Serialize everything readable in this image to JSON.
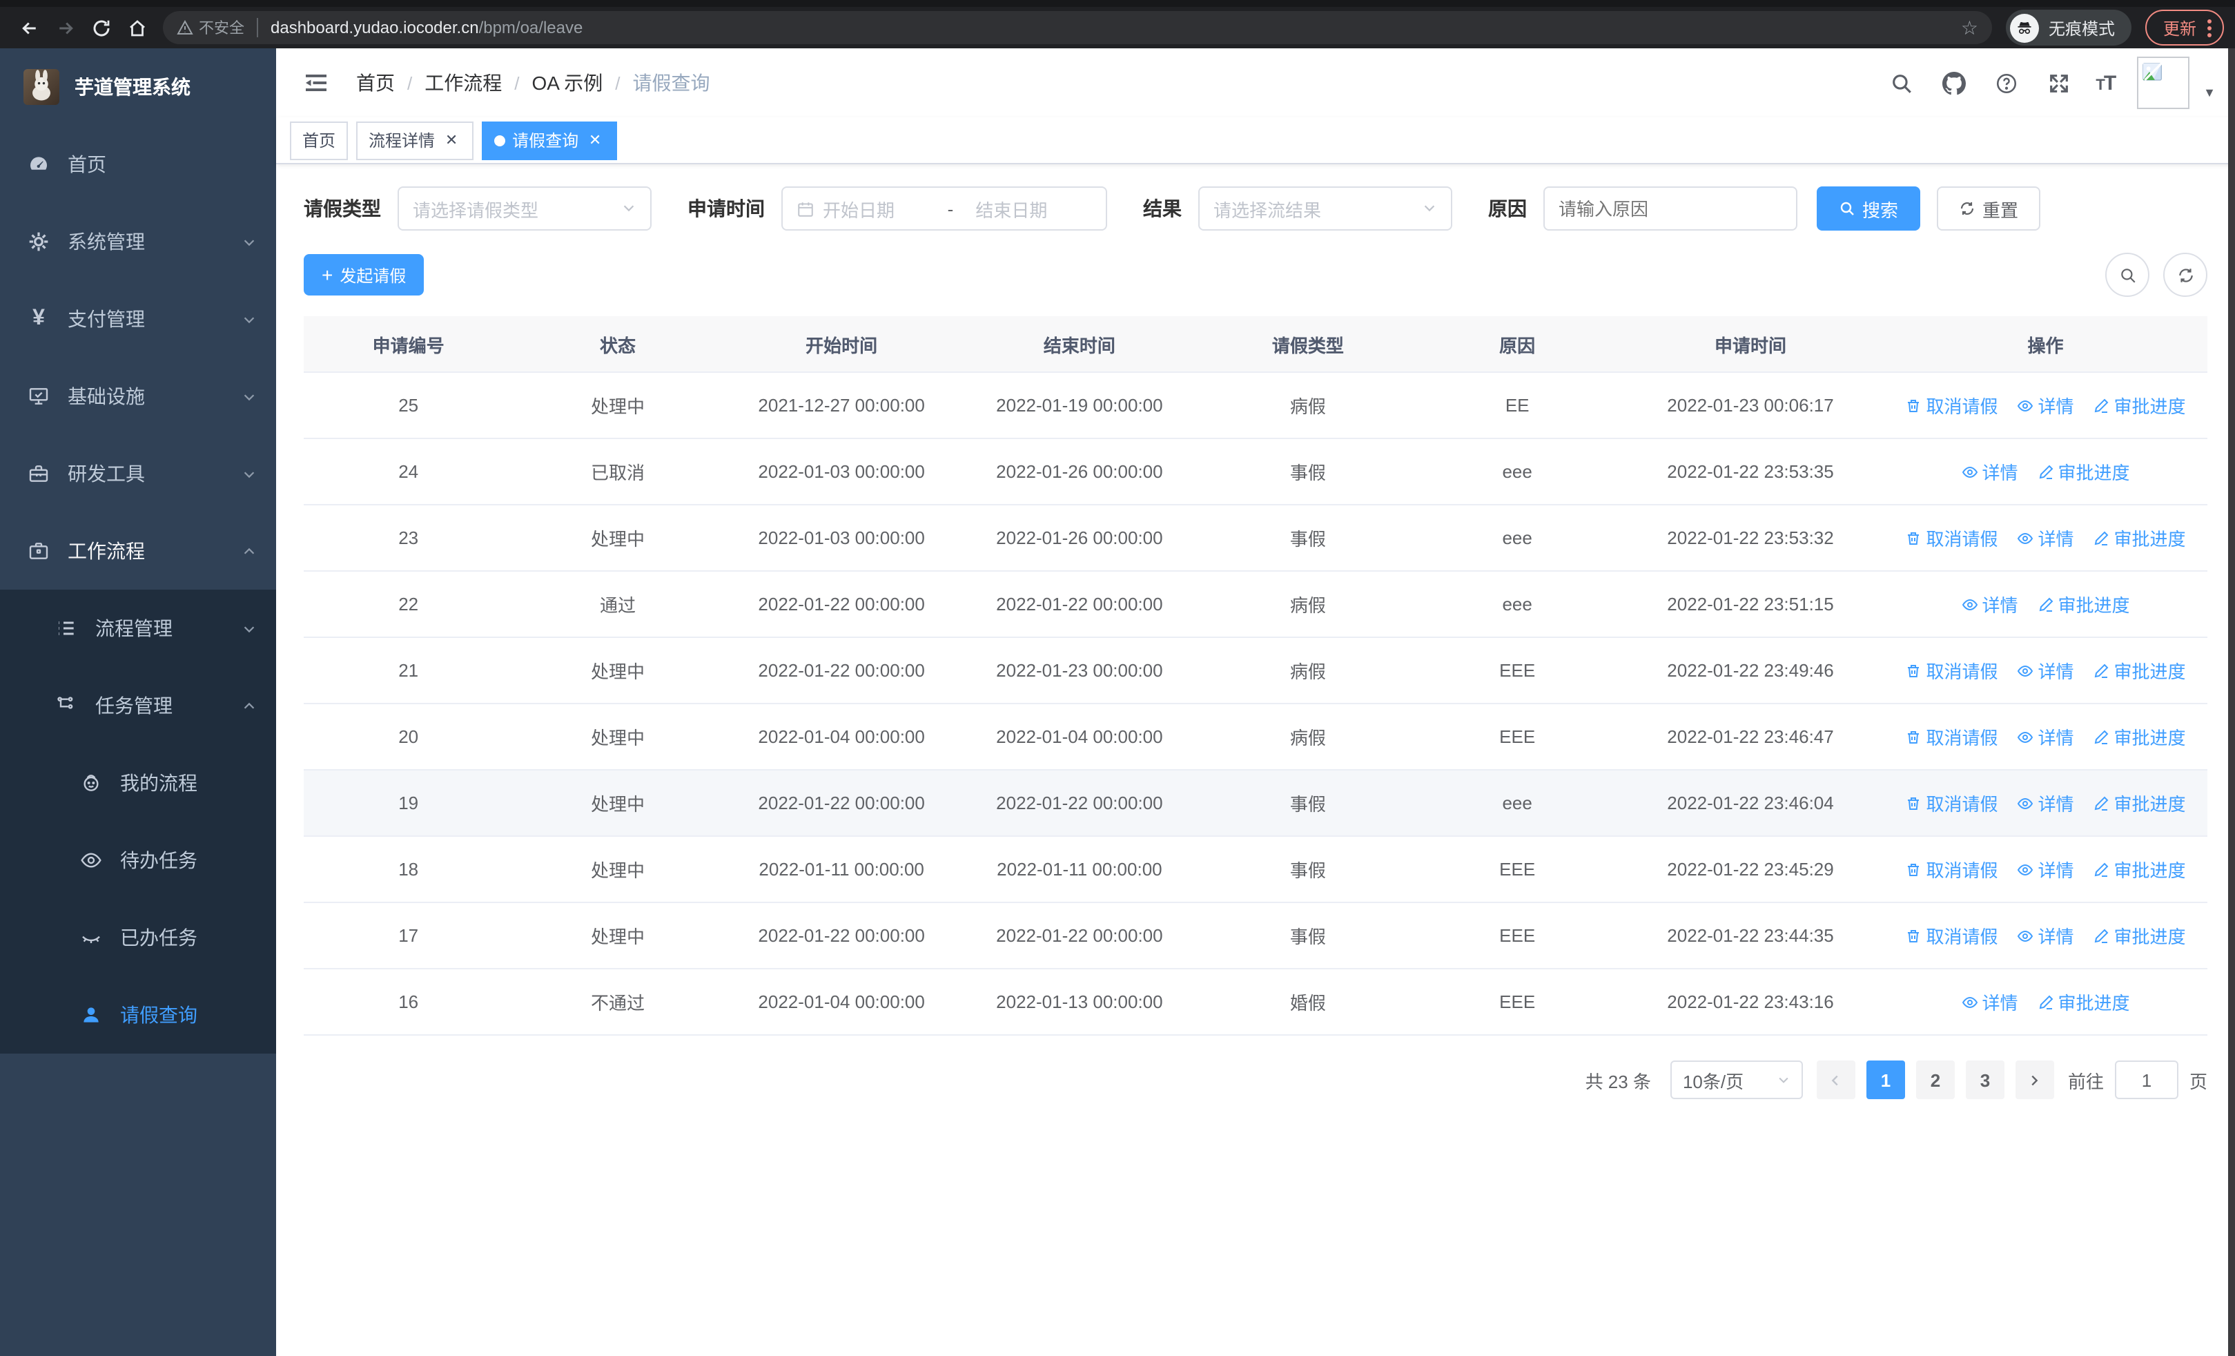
{
  "browser": {
    "security_label": "不安全",
    "url_host": "dashboard.yudao.iocoder.cn",
    "url_path": "/bpm/oa/leave",
    "incognito_label": "无痕模式",
    "update_label": "更新"
  },
  "sidebar": {
    "logo_title": "芋道管理系统",
    "items": [
      {
        "label": "首页"
      },
      {
        "label": "系统管理"
      },
      {
        "label": "支付管理"
      },
      {
        "label": "基础设施"
      },
      {
        "label": "研发工具"
      },
      {
        "label": "工作流程"
      }
    ],
    "workflow_children": [
      {
        "label": "流程管理"
      },
      {
        "label": "任务管理"
      }
    ],
    "task_children": [
      {
        "label": "我的流程"
      },
      {
        "label": "待办任务"
      },
      {
        "label": "已办任务"
      },
      {
        "label": "请假查询"
      }
    ]
  },
  "navbar": {
    "breadcrumb": [
      "首页",
      "工作流程",
      "OA 示例",
      "请假查询"
    ]
  },
  "tags": [
    {
      "label": "首页",
      "closable": false,
      "active": false
    },
    {
      "label": "流程详情",
      "closable": true,
      "active": false
    },
    {
      "label": "请假查询",
      "closable": true,
      "active": true
    }
  ],
  "filters": {
    "leave_type_label": "请假类型",
    "leave_type_placeholder": "请选择请假类型",
    "apply_time_label": "申请时间",
    "start_date_placeholder": "开始日期",
    "range_separator": "-",
    "end_date_placeholder": "结束日期",
    "result_label": "结果",
    "result_placeholder": "请选择流结果",
    "reason_label": "原因",
    "reason_placeholder": "请输入原因",
    "search_label": "搜索",
    "reset_label": "重置"
  },
  "toolbar": {
    "create_label": "发起请假"
  },
  "table": {
    "columns": [
      "申请编号",
      "状态",
      "开始时间",
      "结束时间",
      "请假类型",
      "原因",
      "申请时间",
      "操作"
    ],
    "action_labels": {
      "cancel": "取消请假",
      "detail": "详情",
      "progress": "审批进度"
    },
    "rows": [
      {
        "id": "25",
        "status": "处理中",
        "start": "2021-12-27 00:00:00",
        "end": "2022-01-19 00:00:00",
        "type": "病假",
        "reason": "EE",
        "apply_time": "2022-01-23 00:06:17",
        "actions": [
          "cancel",
          "detail",
          "progress"
        ],
        "highlight": false
      },
      {
        "id": "24",
        "status": "已取消",
        "start": "2022-01-03 00:00:00",
        "end": "2022-01-26 00:00:00",
        "type": "事假",
        "reason": "eee",
        "apply_time": "2022-01-22 23:53:35",
        "actions": [
          "detail",
          "progress"
        ],
        "highlight": false
      },
      {
        "id": "23",
        "status": "处理中",
        "start": "2022-01-03 00:00:00",
        "end": "2022-01-26 00:00:00",
        "type": "事假",
        "reason": "eee",
        "apply_time": "2022-01-22 23:53:32",
        "actions": [
          "cancel",
          "detail",
          "progress"
        ],
        "highlight": false
      },
      {
        "id": "22",
        "status": "通过",
        "start": "2022-01-22 00:00:00",
        "end": "2022-01-22 00:00:00",
        "type": "病假",
        "reason": "eee",
        "apply_time": "2022-01-22 23:51:15",
        "actions": [
          "detail",
          "progress"
        ],
        "highlight": false
      },
      {
        "id": "21",
        "status": "处理中",
        "start": "2022-01-22 00:00:00",
        "end": "2022-01-23 00:00:00",
        "type": "病假",
        "reason": "EEE",
        "apply_time": "2022-01-22 23:49:46",
        "actions": [
          "cancel",
          "detail",
          "progress"
        ],
        "highlight": false
      },
      {
        "id": "20",
        "status": "处理中",
        "start": "2022-01-04 00:00:00",
        "end": "2022-01-04 00:00:00",
        "type": "病假",
        "reason": "EEE",
        "apply_time": "2022-01-22 23:46:47",
        "actions": [
          "cancel",
          "detail",
          "progress"
        ],
        "highlight": false
      },
      {
        "id": "19",
        "status": "处理中",
        "start": "2022-01-22 00:00:00",
        "end": "2022-01-22 00:00:00",
        "type": "事假",
        "reason": "eee",
        "apply_time": "2022-01-22 23:46:04",
        "actions": [
          "cancel",
          "detail",
          "progress"
        ],
        "highlight": true
      },
      {
        "id": "18",
        "status": "处理中",
        "start": "2022-01-11 00:00:00",
        "end": "2022-01-11 00:00:00",
        "type": "事假",
        "reason": "EEE",
        "apply_time": "2022-01-22 23:45:29",
        "actions": [
          "cancel",
          "detail",
          "progress"
        ],
        "highlight": false
      },
      {
        "id": "17",
        "status": "处理中",
        "start": "2022-01-22 00:00:00",
        "end": "2022-01-22 00:00:00",
        "type": "事假",
        "reason": "EEE",
        "apply_time": "2022-01-22 23:44:35",
        "actions": [
          "cancel",
          "detail",
          "progress"
        ],
        "highlight": false
      },
      {
        "id": "16",
        "status": "不通过",
        "start": "2022-01-04 00:00:00",
        "end": "2022-01-13 00:00:00",
        "type": "婚假",
        "reason": "EEE",
        "apply_time": "2022-01-22 23:43:16",
        "actions": [
          "detail",
          "progress"
        ],
        "highlight": false
      }
    ]
  },
  "pagination": {
    "total_label": "共 23 条",
    "page_size_label": "10条/页",
    "pages": [
      "1",
      "2",
      "3"
    ],
    "active_page": "1",
    "goto_label": "前往",
    "goto_value": "1",
    "goto_suffix": "页"
  },
  "colors": {
    "primary": "#409eff",
    "sidebar_bg": "#304156",
    "submenu_bg": "#1f2d3d"
  }
}
